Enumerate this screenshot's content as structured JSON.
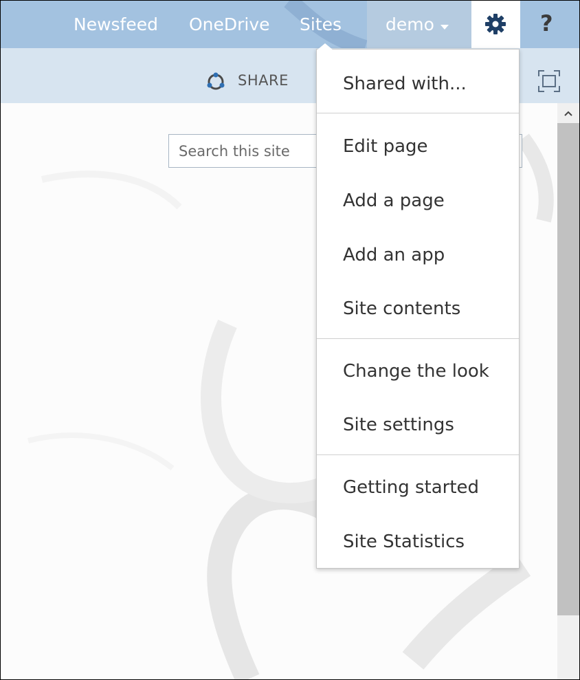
{
  "nav": {
    "links": [
      "Newsfeed",
      "OneDrive",
      "Sites"
    ],
    "user": "demo",
    "settings_icon": "gear-icon",
    "help_label": "?"
  },
  "ribbon": {
    "share_label": "SHARE"
  },
  "search": {
    "placeholder": "Search this site"
  },
  "menu": {
    "groups": [
      [
        "Shared with..."
      ],
      [
        "Edit page",
        "Add a page",
        "Add an app",
        "Site contents"
      ],
      [
        "Change the look",
        "Site settings"
      ],
      [
        "Getting started",
        "Site Statistics"
      ]
    ]
  },
  "colors": {
    "suitebar": "#a3c2e0",
    "ribbon": "#d7e4f0",
    "menu_text": "#333333"
  }
}
